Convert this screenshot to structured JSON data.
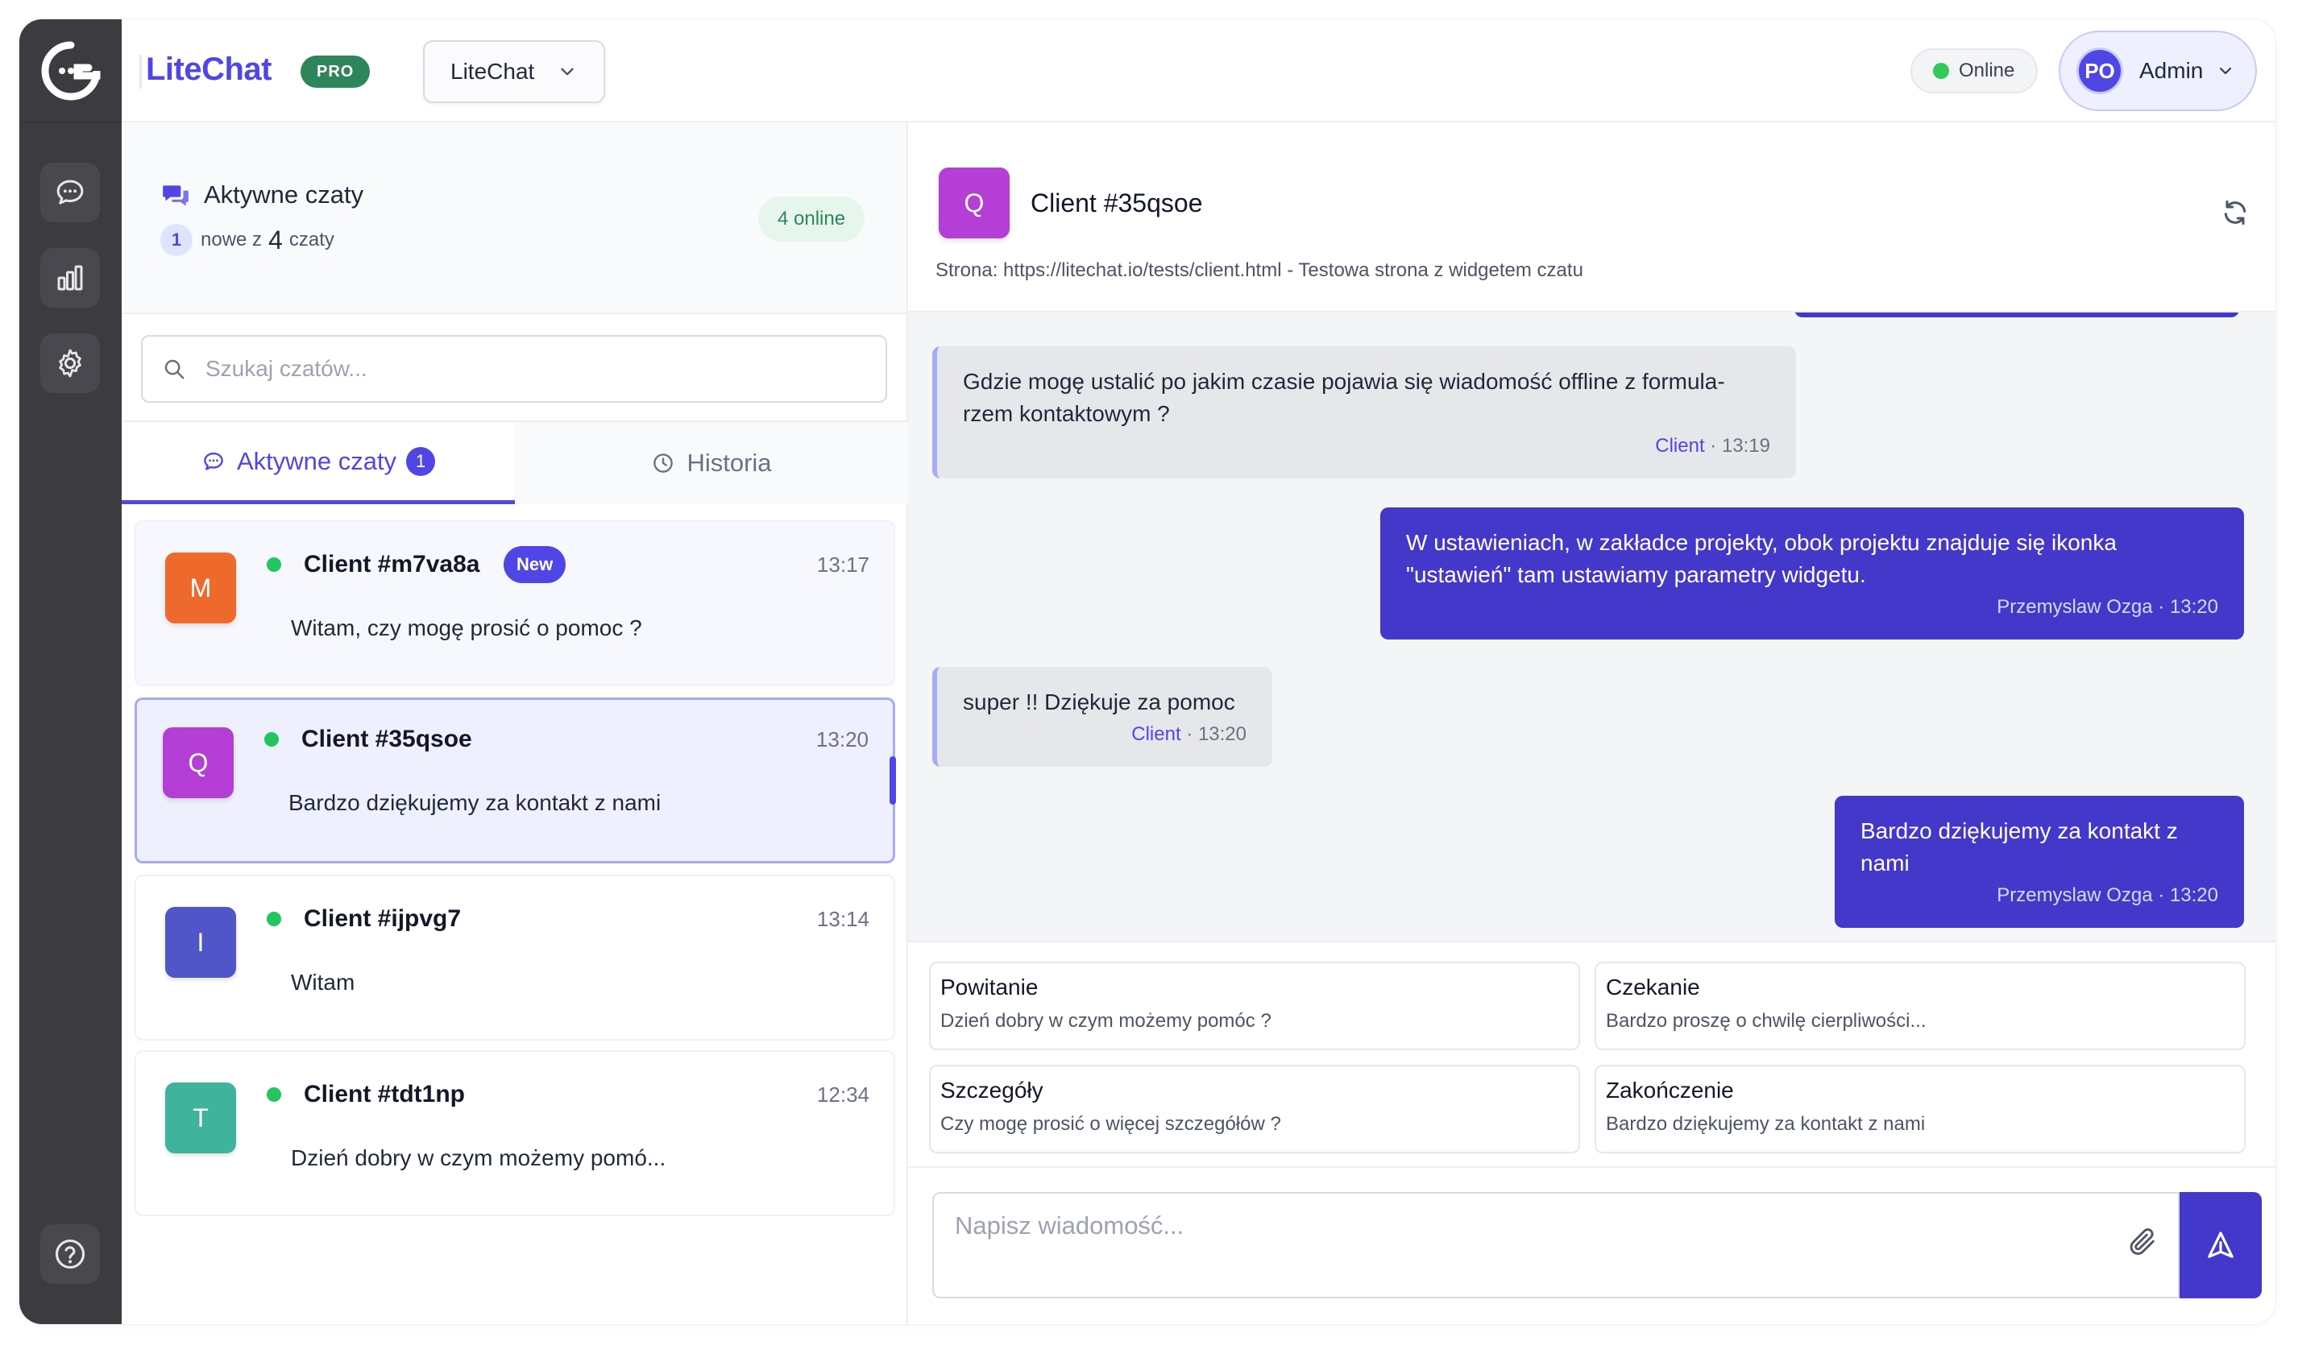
{
  "app": {
    "brand": "LiteChat",
    "plan_badge": "PRO",
    "project_selector": "LiteChat",
    "status": "Online",
    "user": {
      "initials": "PO",
      "name": "Admin"
    }
  },
  "sidebar": {
    "items": [
      {
        "icon": "chat-bubble-icon"
      },
      {
        "icon": "bar-chart-icon"
      },
      {
        "icon": "gear-icon"
      }
    ],
    "help_icon": "help-circle-icon"
  },
  "chat_list": {
    "title": "Aktywne czaty",
    "new_count": "1",
    "new_label": "nowe z",
    "total_count": "4",
    "total_label": "czaty",
    "online_badge": "4 online",
    "search_placeholder": "Szukaj czatów...",
    "tabs": [
      {
        "label": "Aktywne czaty",
        "badge": "1"
      },
      {
        "label": "Historia"
      }
    ],
    "chats": [
      {
        "initial": "M",
        "color": "#ee6a2c",
        "name": "Client #m7va8a",
        "badge": "New",
        "time": "13:17",
        "preview": "Witam, czy mogę prosić o pomoc ?"
      },
      {
        "initial": "Q",
        "color": "#b43ed6",
        "name": "Client #35qsoe",
        "time": "13:20",
        "preview": "Bardzo dziękujemy za kontakt z nami"
      },
      {
        "initial": "I",
        "color": "#5055c8",
        "name": "Client #ijpvg7",
        "time": "13:14",
        "preview": "Witam"
      },
      {
        "initial": "T",
        "color": "#3fb39b",
        "name": "Client #tdt1np",
        "time": "12:34",
        "preview": "Dzień dobry w czym możemy pomó..."
      }
    ]
  },
  "conversation": {
    "initial": "Q",
    "name": "Client #35qsoe",
    "page_info": "Strona: https://litechat.io/tests/client.html - Testowa strona z widgetem czatu",
    "messages": [
      {
        "from": "client",
        "text": "Gdzie mogę ustalić po jakim czasie pojawia się wiadomość offline z formula- rzem kontaktowym ?",
        "author": "Client",
        "time": "13:19"
      },
      {
        "from": "agent",
        "text": "W ustawieniach, w zakładce projekty, obok projektu znajduje się ikonka \"ustawień\" tam ustawiamy parametry widgetu.",
        "author": "Przemyslaw Ozga",
        "time": "13:20"
      },
      {
        "from": "client",
        "text": "super !! Dziękuje za pomoc",
        "author": "Client",
        "time": "13:20"
      },
      {
        "from": "agent",
        "text": "Bardzo dziękujemy za kontakt z nami",
        "author": "Przemyslaw Ozga",
        "time": "13:20"
      }
    ],
    "quick_replies": [
      {
        "title": "Powitanie",
        "text": "Dzień dobry w czym możemy pomóc ?"
      },
      {
        "title": "Czekanie",
        "text": "Bardzo proszę o chwilę cierpliwości..."
      },
      {
        "title": "Szczegóły",
        "text": "Czy mogę prosić o więcej szczegółów ?"
      },
      {
        "title": "Zakończenie",
        "text": "Bardzo dziękujemy za kontakt z nami"
      }
    ],
    "composer_placeholder": "Napisz wiadomość..."
  }
}
